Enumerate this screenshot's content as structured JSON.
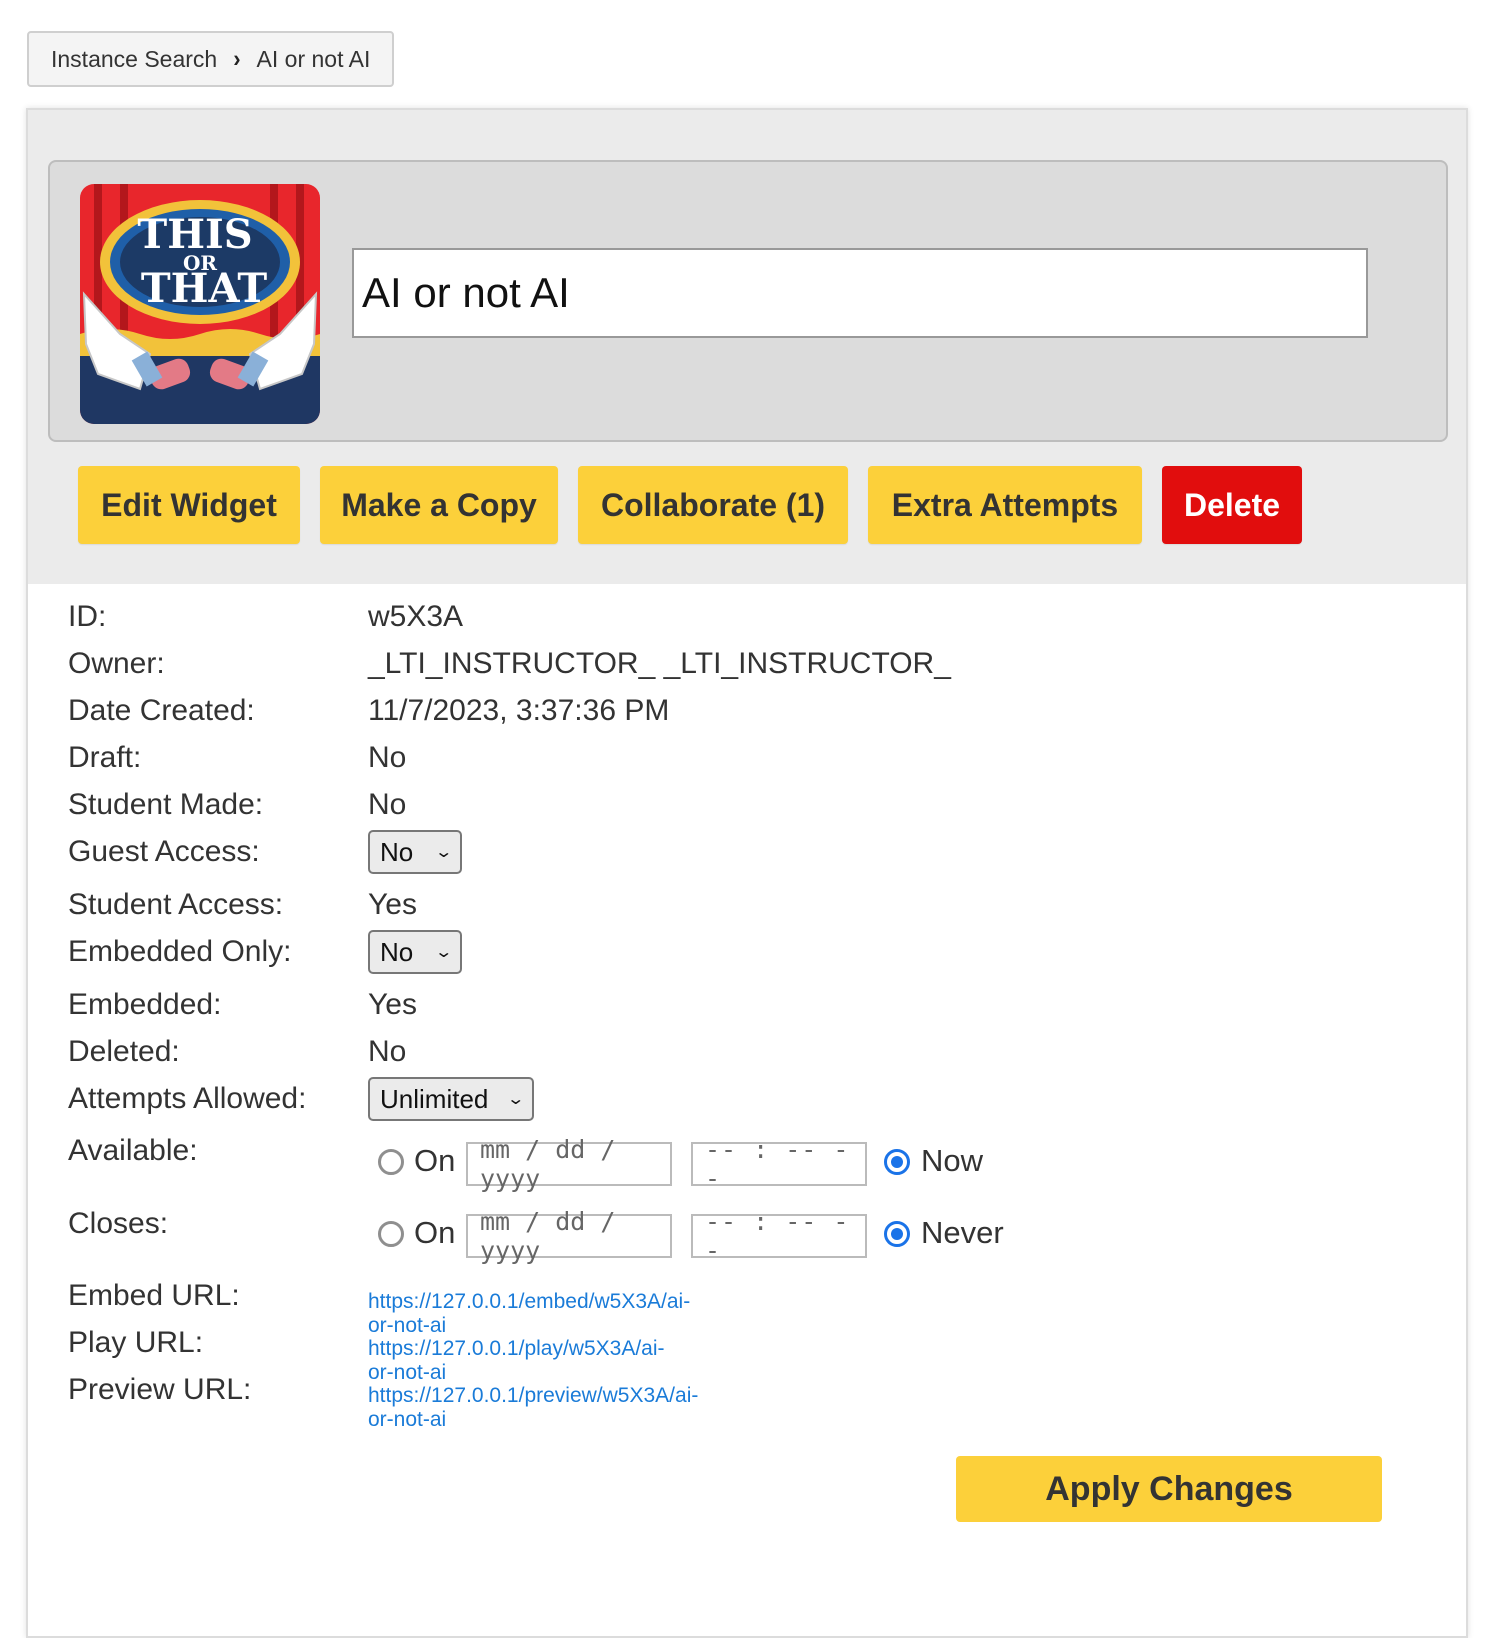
{
  "breadcrumb": {
    "root": "Instance Search",
    "current": "AI or not AI"
  },
  "header": {
    "title_value": "AI or not AI",
    "icon_logo_text": [
      "THIS",
      "OR",
      "THAT"
    ]
  },
  "actions": {
    "edit": "Edit Widget",
    "copy": "Make a Copy",
    "collaborate": "Collaborate (1)",
    "extra_attempts": "Extra Attempts",
    "delete": "Delete"
  },
  "details": {
    "id": {
      "label": "ID:",
      "value": "w5X3A"
    },
    "owner": {
      "label": "Owner:",
      "value": "_LTI_INSTRUCTOR_ _LTI_INSTRUCTOR_"
    },
    "date_created": {
      "label": "Date Created:",
      "value": "11/7/2023, 3:37:36 PM"
    },
    "draft": {
      "label": "Draft:",
      "value": "No"
    },
    "student_made": {
      "label": "Student Made:",
      "value": "No"
    },
    "guest_access": {
      "label": "Guest Access:",
      "value": "No"
    },
    "student_access": {
      "label": "Student Access:",
      "value": "Yes"
    },
    "embedded_only": {
      "label": "Embedded Only:",
      "value": "No"
    },
    "embedded": {
      "label": "Embedded:",
      "value": "Yes"
    },
    "deleted": {
      "label": "Deleted:",
      "value": "No"
    },
    "attempts_allowed": {
      "label": "Attempts Allowed:",
      "value": "Unlimited"
    },
    "available": {
      "label": "Available:",
      "on_label": "On",
      "date_placeholder": "mm / dd / yyyy",
      "time_placeholder": "-- : --  --",
      "alt_label": "Now",
      "selected": "Now"
    },
    "closes": {
      "label": "Closes:",
      "on_label": "On",
      "date_placeholder": "mm / dd / yyyy",
      "time_placeholder": "-- : --  --",
      "alt_label": "Never",
      "selected": "Never"
    },
    "embed_url": {
      "label": "Embed URL:",
      "value": "https://127.0.0.1/embed/w5X3A/ai-or-not-ai"
    },
    "play_url": {
      "label": "Play URL:",
      "value": "https://127.0.0.1/play/w5X3A/ai-or-not-ai"
    },
    "preview_url": {
      "label": "Preview URL:",
      "value": "https://127.0.0.1/preview/w5X3A/ai-or-not-ai"
    }
  },
  "apply_label": "Apply Changes",
  "colors": {
    "accent_yellow": "#fcd03a",
    "delete_red": "#e10d0d",
    "link_blue": "#1a7bd8",
    "radio_blue": "#1a73e8"
  }
}
